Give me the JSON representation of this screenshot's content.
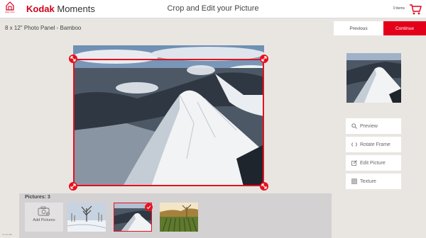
{
  "header": {
    "home_label": "Start Over",
    "brand_name": "Kodak",
    "brand_suffix": "Moments",
    "title": "Crop and Edit your Picture",
    "cart_count": "0 items"
  },
  "product": {
    "name": "8 x 12\" Photo Panel - Bamboo"
  },
  "nav": {
    "previous_label": "Previous",
    "continue_label": "Continue"
  },
  "actions": {
    "preview_label": "Preview",
    "rotate_label": "Rotate Frame",
    "edit_label": "Edit Picture",
    "texture_label": "Texture"
  },
  "tray": {
    "title": "Pictures: 3",
    "add_label": "Add Pictures"
  },
  "footer": {
    "note": "rcl-rtlu-dkh"
  },
  "colors": {
    "accent": "#e4001b",
    "background": "#e9e6e2",
    "tray": "#d4d1d3"
  }
}
